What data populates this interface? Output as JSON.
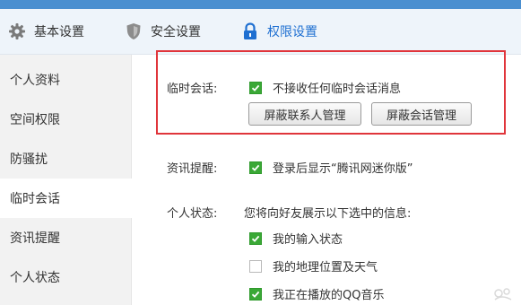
{
  "tabs": [
    {
      "label": "基本设置",
      "icon": "gear-icon"
    },
    {
      "label": "安全设置",
      "icon": "shield-icon"
    },
    {
      "label": "权限设置",
      "icon": "lock-icon",
      "active": true
    }
  ],
  "sidebar": {
    "items": [
      {
        "label": "个人资料"
      },
      {
        "label": "空间权限"
      },
      {
        "label": "防骚扰"
      },
      {
        "label": "临时会话",
        "active": true
      },
      {
        "label": "资讯提醒"
      },
      {
        "label": "个人状态"
      }
    ]
  },
  "temp_session": {
    "label": "临时会话:",
    "checkbox_label": "不接收任何临时会话消息",
    "checked": true,
    "btn_block_contacts": "屏蔽联系人管理",
    "btn_block_sessions": "屏蔽会话管理"
  },
  "news_reminder": {
    "label": "资讯提醒:",
    "checkbox_label": "登录后显示“腾讯网迷你版”",
    "checked": true
  },
  "personal_status": {
    "label": "个人状态:",
    "description": "您将向好友展示以下选中的信息:",
    "options": [
      {
        "label": "我的输入状态",
        "checked": true
      },
      {
        "label": "我的地理位置及天气",
        "checked": false
      },
      {
        "label": "我正在播放的QQ音乐",
        "checked": true
      }
    ]
  },
  "colors": {
    "accent": "#1e6fd1",
    "checkbox_green": "#3aa836",
    "highlight_red": "#e0353b"
  }
}
